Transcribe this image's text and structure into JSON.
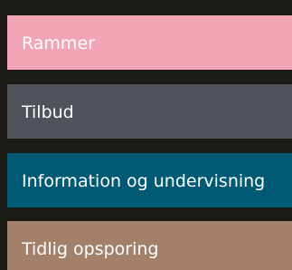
{
  "menu": {
    "items": [
      {
        "label": "Rammer",
        "background": "#f2a5b6",
        "text_color": "#ffffff"
      },
      {
        "label": "Tilbud",
        "background": "#4f5259",
        "text_color": "#ffffff"
      },
      {
        "label": "Information og undervisning",
        "background": "#005a73",
        "text_color": "#ffffff"
      },
      {
        "label": "Tidlig opsporing",
        "background": "#a3806a",
        "text_color": "#ffffff"
      }
    ]
  }
}
